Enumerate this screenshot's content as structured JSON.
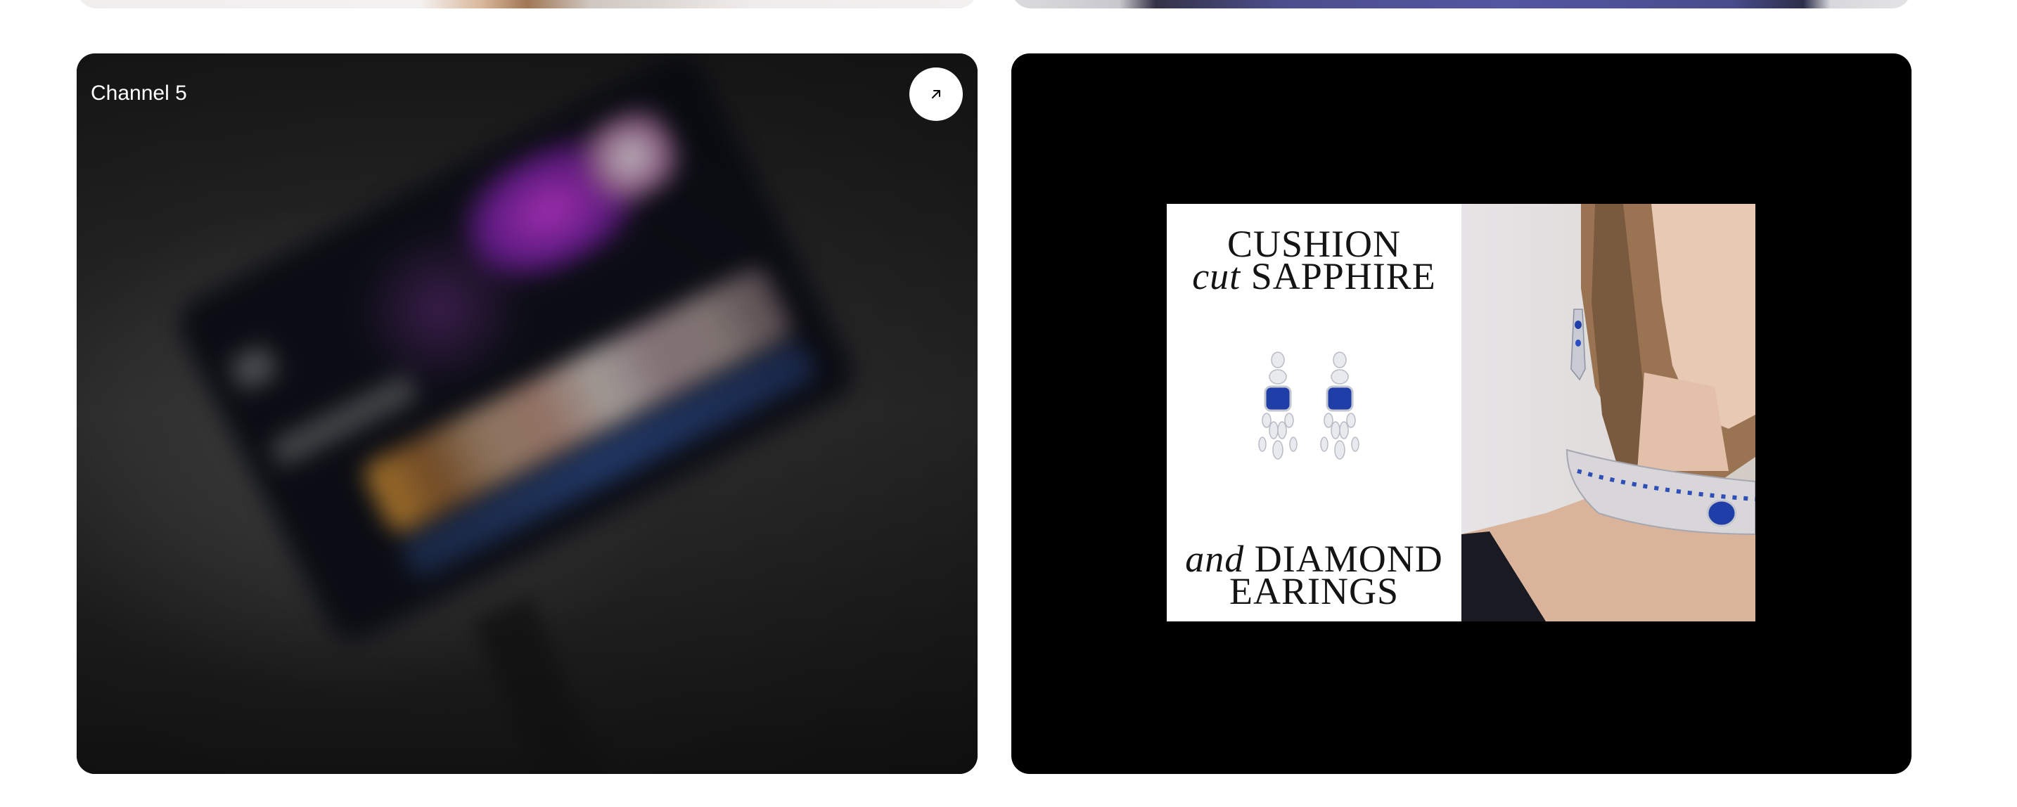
{
  "cards": [
    {
      "label": "Channel 5",
      "link_icon": "arrow-up-right-icon"
    },
    {
      "ad": {
        "line1": "CUSHION",
        "line2_italic": "cut",
        "line2_rest": " SAPPHIRE",
        "line3_italic": "and",
        "line3_rest": " DIAMOND",
        "line4": "EARINGS"
      }
    }
  ],
  "colors": {
    "page_bg": "#ffffff",
    "left_card_bg": "#171717",
    "right_card_bg": "#000000",
    "sapphire": "#1f3ea8"
  }
}
